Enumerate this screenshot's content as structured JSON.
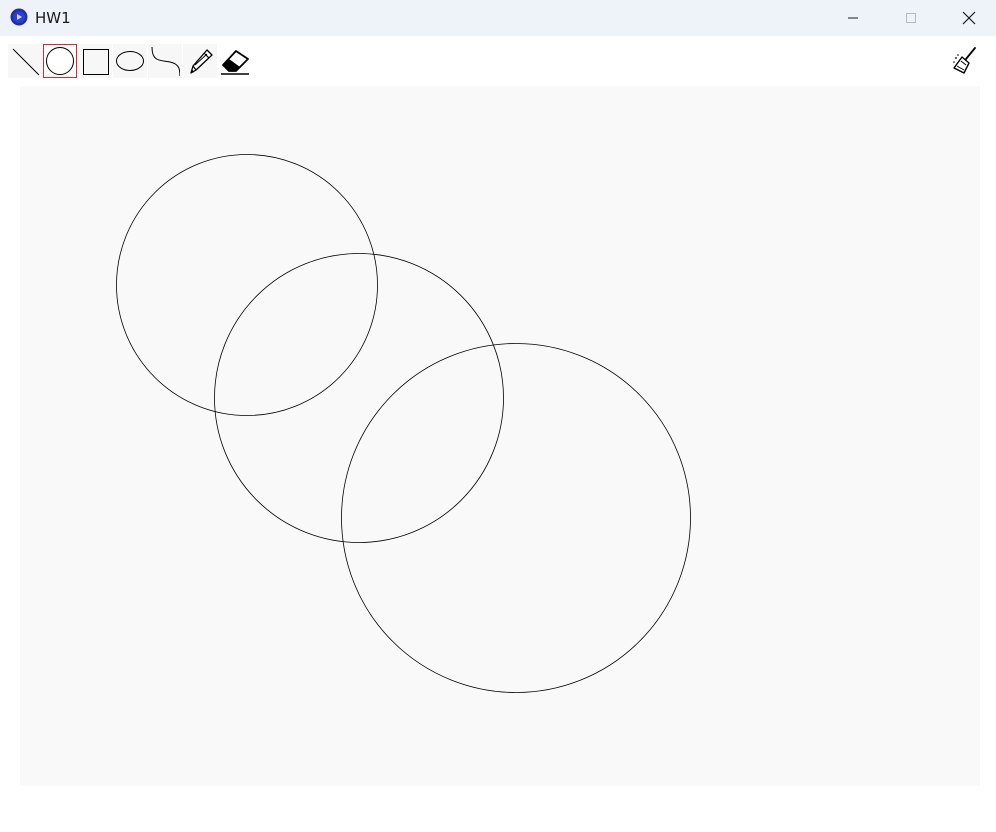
{
  "window": {
    "title": "HW1",
    "minimize_icon": "minimize-icon",
    "maximize_icon": "maximize-icon",
    "close_icon": "close-icon"
  },
  "toolbar": {
    "tools": [
      {
        "name": "line",
        "icon": "line-icon",
        "selected": false
      },
      {
        "name": "circle",
        "icon": "circle-icon",
        "selected": true
      },
      {
        "name": "rectangle",
        "icon": "rectangle-icon",
        "selected": false
      },
      {
        "name": "ellipse",
        "icon": "ellipse-icon",
        "selected": false
      },
      {
        "name": "curve",
        "icon": "curve-icon",
        "selected": false
      },
      {
        "name": "pencil",
        "icon": "pencil-icon",
        "selected": false
      },
      {
        "name": "eraser",
        "icon": "eraser-icon",
        "selected": false
      }
    ],
    "clear_tool": {
      "name": "clear",
      "icon": "broom-icon"
    }
  },
  "colors": {
    "titlebar_bg": "#eef3f9",
    "canvas_bg": "#f9f9f9",
    "selected_border": "#d9282f",
    "stroke": "#000000"
  }
}
